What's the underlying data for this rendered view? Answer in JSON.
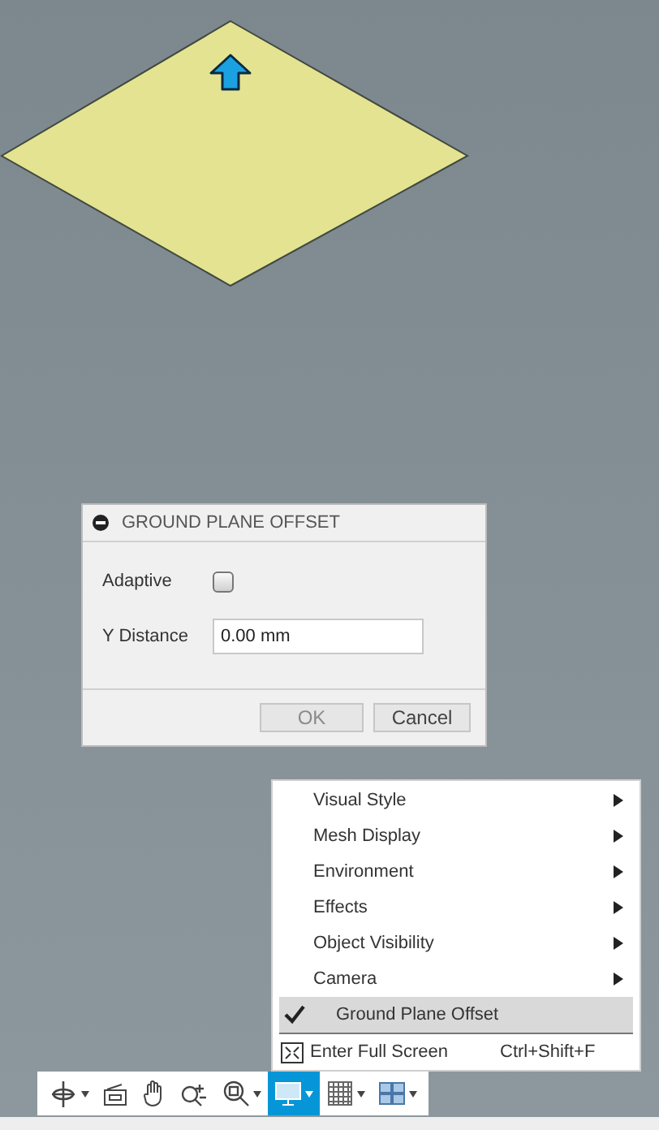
{
  "dialog": {
    "title": "GROUND PLANE OFFSET",
    "fields": [
      {
        "kind": "checkbox",
        "label": "Adaptive",
        "checked": false
      },
      {
        "kind": "text",
        "label": "Y Distance",
        "value": "0.00 mm"
      }
    ],
    "buttons": [
      {
        "label": "OK",
        "disabled": true
      },
      {
        "label": "Cancel",
        "disabled": false
      }
    ]
  },
  "menu": {
    "items": [
      {
        "kind": "submenu",
        "label": "Visual Style"
      },
      {
        "kind": "submenu",
        "label": "Mesh Display"
      },
      {
        "kind": "submenu",
        "label": "Environment"
      },
      {
        "kind": "submenu",
        "label": "Effects"
      },
      {
        "kind": "submenu",
        "label": "Object Visibility"
      },
      {
        "kind": "submenu",
        "label": "Camera"
      },
      {
        "kind": "check",
        "label": "Ground Plane Offset",
        "checked": true,
        "selected": true
      },
      {
        "kind": "command",
        "label": "Enter Full Screen",
        "shortcut": "Ctrl+Shift+F",
        "selected": false
      }
    ]
  },
  "toolbar": {
    "tools": [
      {
        "kind": "orbit",
        "dropdown": true,
        "selected": false
      },
      {
        "kind": "look",
        "dropdown": false,
        "selected": false
      },
      {
        "kind": "pan",
        "dropdown": false,
        "selected": false
      },
      {
        "kind": "zoom",
        "dropdown": false,
        "selected": false
      },
      {
        "kind": "fit",
        "dropdown": true,
        "selected": false
      },
      {
        "kind": "display",
        "dropdown": true,
        "selected": true
      },
      {
        "kind": "grid",
        "dropdown": true,
        "selected": false
      },
      {
        "kind": "viewports",
        "dropdown": true,
        "selected": false
      }
    ]
  }
}
